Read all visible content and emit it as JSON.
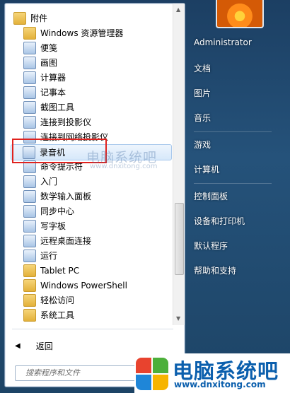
{
  "left_panel": {
    "items": [
      {
        "label": "附件",
        "icon": "folder-icon",
        "kind": "folder",
        "top": true
      },
      {
        "label": "Windows 资源管理器",
        "icon": "folder-icon",
        "kind": "folder"
      },
      {
        "label": "便笺",
        "icon": "sticky-notes-icon",
        "kind": "app"
      },
      {
        "label": "画图",
        "icon": "paint-icon",
        "kind": "app"
      },
      {
        "label": "计算器",
        "icon": "calculator-icon",
        "kind": "app"
      },
      {
        "label": "记事本",
        "icon": "notepad-icon",
        "kind": "app"
      },
      {
        "label": "截图工具",
        "icon": "snipping-tool-icon",
        "kind": "app"
      },
      {
        "label": "连接到投影仪",
        "icon": "projector-icon",
        "kind": "app"
      },
      {
        "label": "连接到网络投影仪",
        "icon": "network-projector-icon",
        "kind": "app"
      },
      {
        "label": "录音机",
        "icon": "microphone-icon",
        "kind": "app",
        "selected": true
      },
      {
        "label": "命令提示符",
        "icon": "command-prompt-icon",
        "kind": "app"
      },
      {
        "label": "入门",
        "icon": "getting-started-icon",
        "kind": "app"
      },
      {
        "label": "数学输入面板",
        "icon": "math-input-icon",
        "kind": "app"
      },
      {
        "label": "同步中心",
        "icon": "sync-center-icon",
        "kind": "app"
      },
      {
        "label": "写字板",
        "icon": "wordpad-icon",
        "kind": "app"
      },
      {
        "label": "远程桌面连接",
        "icon": "remote-desktop-icon",
        "kind": "app"
      },
      {
        "label": "运行",
        "icon": "run-icon",
        "kind": "app"
      },
      {
        "label": "Tablet PC",
        "icon": "folder-icon",
        "kind": "folder"
      },
      {
        "label": "Windows PowerShell",
        "icon": "folder-icon",
        "kind": "folder"
      },
      {
        "label": "轻松访问",
        "icon": "folder-icon",
        "kind": "folder"
      },
      {
        "label": "系统工具",
        "icon": "folder-icon",
        "kind": "folder"
      }
    ],
    "back_label": "返回",
    "search_placeholder": "搜索程序和文件"
  },
  "right_panel": {
    "user_name": "Administrator",
    "items": [
      "文档",
      "图片",
      "音乐",
      "游戏",
      "计算机",
      "控制面板",
      "设备和打印机",
      "默认程序",
      "帮助和支持"
    ]
  },
  "watermark": {
    "title": "电脑系统吧",
    "url": "www.dnxitong.com"
  },
  "logo": {
    "title": "电脑系统吧",
    "url": "www.dnxitong.com",
    "colors": [
      "#e8432e",
      "#4caf3a",
      "#1f86d8",
      "#f6b400"
    ]
  }
}
